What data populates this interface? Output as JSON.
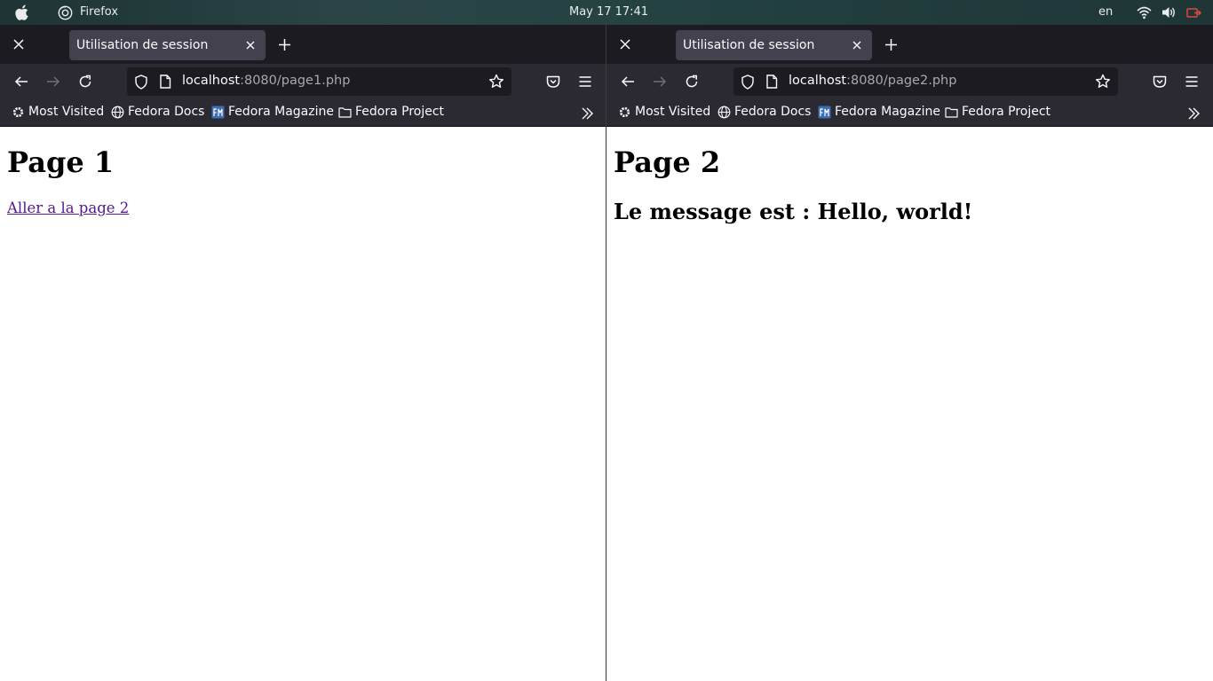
{
  "topbar": {
    "app_name": "Firefox",
    "date": "May 17",
    "time": "17:41",
    "language": "en"
  },
  "windows": [
    {
      "tab_title": "Utilisation de session",
      "url_host": "localhost",
      "url_rest": ":8080/page1.php",
      "bookmarks": [
        "Most Visited",
        "Fedora Docs",
        "Fedora Magazine",
        "Fedora Project"
      ],
      "page": {
        "heading": "Page 1",
        "link": "Aller a la page 2"
      }
    },
    {
      "tab_title": "Utilisation de session",
      "url_host": "localhost",
      "url_rest": ":8080/page2.php",
      "bookmarks": [
        "Most Visited",
        "Fedora Docs",
        "Fedora Magazine",
        "Fedora Project"
      ],
      "page": {
        "heading": "Page 2",
        "message": "Le message est : Hello, world!"
      }
    }
  ],
  "colors": {
    "tab_strip": "#1c1b22",
    "toolbar": "#2b2a33",
    "active_tab": "#42414d",
    "visited_link": "#551a8b",
    "accent_red": "#e0463c"
  }
}
